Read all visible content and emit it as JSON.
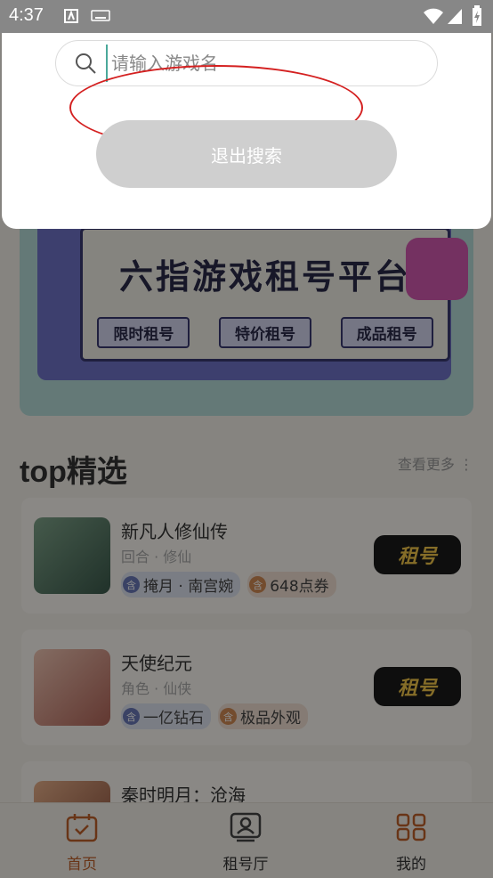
{
  "status_bar": {
    "time": "4:37"
  },
  "search": {
    "placeholder": "请输入游戏名",
    "exit_label": "退出搜索"
  },
  "banner": {
    "title": "六指游戏租号平台",
    "tags": [
      "限时租号",
      "特价租号",
      "成品租号"
    ]
  },
  "section": {
    "title": "top精选",
    "more_label": "查看更多"
  },
  "games": [
    {
      "name": "新凡人修仙传",
      "genre": "回合 · 修仙",
      "tags": [
        "掩月 · 南宫婉",
        "648点券"
      ],
      "rent_label": "租号"
    },
    {
      "name": "天使纪元",
      "genre": "角色 · 仙侠",
      "tags": [
        "一亿钻石",
        "极品外观"
      ],
      "rent_label": "租号"
    },
    {
      "name": "秦时明月：沧海",
      "genre": "",
      "tags": [],
      "rent_label": ""
    }
  ],
  "tag_badge": "含",
  "tabbar": {
    "home": "首页",
    "rental_hall": "租号厅",
    "mine": "我的"
  },
  "colors": {
    "accent": "#c0622a",
    "rent_text": "#f2c64a",
    "annotation": "#d42020"
  }
}
